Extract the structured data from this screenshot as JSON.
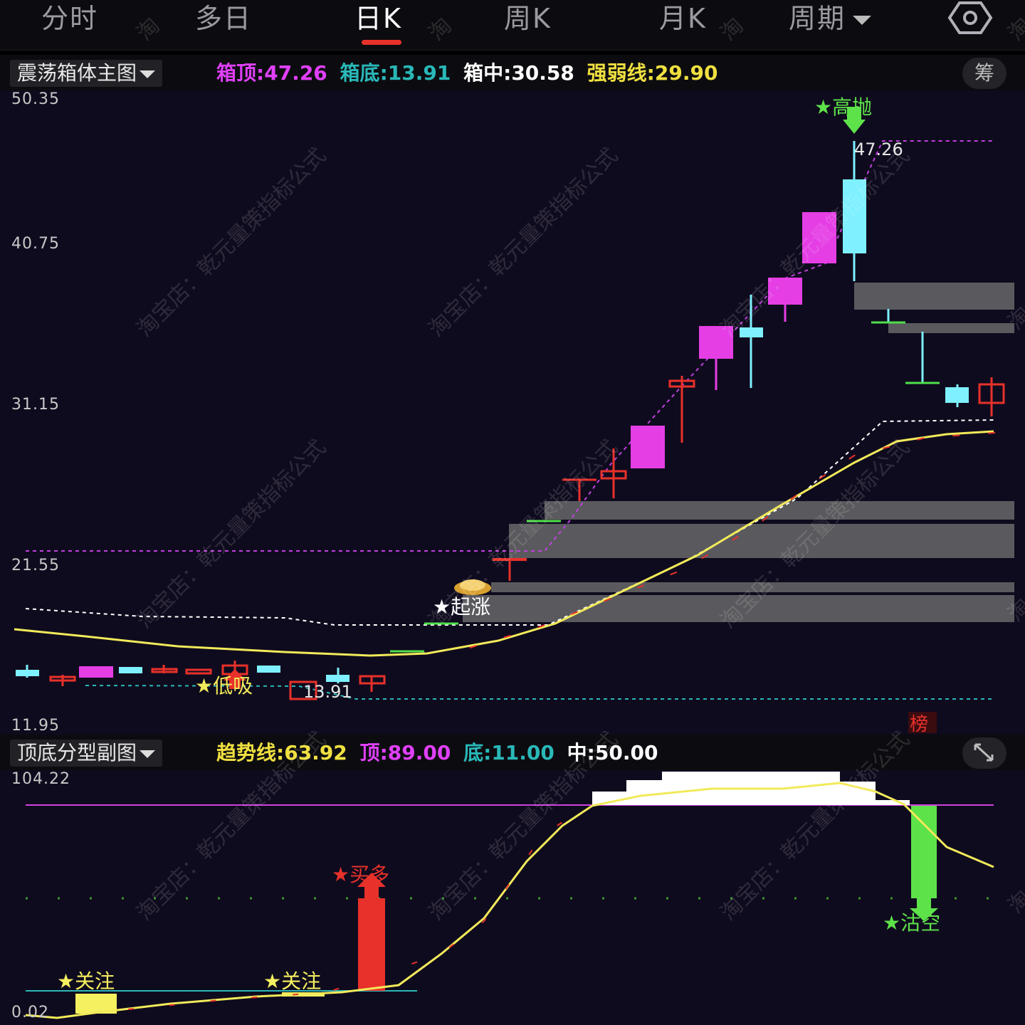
{
  "tabs": [
    {
      "label": "分时"
    },
    {
      "label": "多日"
    },
    {
      "label": "日K"
    },
    {
      "label": "周K"
    },
    {
      "label": "月K"
    },
    {
      "label": "周期"
    }
  ],
  "active_tab": "日K",
  "main_panel": {
    "selector": "震荡箱体主图",
    "legend": [
      {
        "label": "箱顶",
        "value": "47.26",
        "color": "#e040fb"
      },
      {
        "label": "箱底",
        "value": "13.91",
        "color": "#2ab8b8"
      },
      {
        "label": "箱中",
        "value": "30.58",
        "color": "#ffffff"
      },
      {
        "label": "强弱线",
        "value": "29.90",
        "color": "#f0e040"
      }
    ],
    "chip_button": "筹",
    "y_ticks": [
      "50.35",
      "40.75",
      "31.15",
      "21.55",
      "11.95"
    ],
    "box_top_label": "47.26",
    "box_bottom_label": "13.91",
    "signals": {
      "high_sell": "★高抛",
      "start_rise": "★起涨",
      "low_buy": "★低吸"
    },
    "rank_badge": "榜"
  },
  "sub_panel": {
    "selector": "顶底分型副图",
    "legend": [
      {
        "label": "趋势线",
        "value": "63.92",
        "color": "#f0e040"
      },
      {
        "label": "顶",
        "value": "89.00",
        "color": "#e040fb"
      },
      {
        "label": "底",
        "value": "11.00",
        "color": "#2ab8b8"
      },
      {
        "label": "中",
        "value": "50.00",
        "color": "#ffffff"
      }
    ],
    "y_ticks": [
      "104.22",
      "0.02"
    ],
    "signals": {
      "watch_1": "★关注",
      "watch_2": "★关注",
      "buy_long": "★买多",
      "short_sell": "★沽空"
    }
  },
  "watermarks": [
    "淘宝店：乾元量策指标公式",
    "淘"
  ],
  "colors": {
    "up": "#e8312a",
    "down_cyan": "#7ef0ff",
    "magenta": "#e53ee5",
    "trend": "#f2ea5a",
    "sell_green": "#5ee24a"
  }
}
